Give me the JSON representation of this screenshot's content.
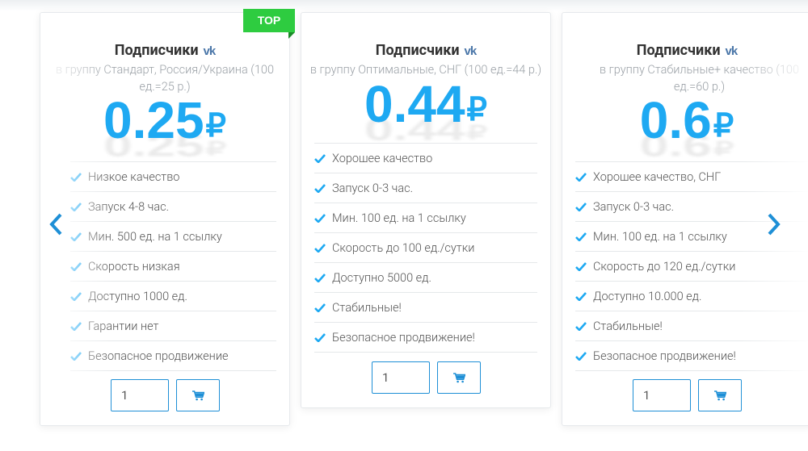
{
  "badge": "TOP",
  "colors": {
    "accent": "#1ea9f2",
    "button_border": "#1e8fd6",
    "badge": "#2ecc40",
    "check": "#1ea9f2",
    "vk": "#4a76a8"
  },
  "icons": {
    "network": "vk-icon",
    "check": "checkmark-icon",
    "cart": "cart-icon",
    "prev": "chevron-left-icon",
    "next": "chevron-right-icon"
  },
  "cards": [
    {
      "title": "Подписчики",
      "vk": "vk",
      "subtitle": "в группу Стандарт, Россия/Украина (100 ед.=25 р.)",
      "price": "0.25",
      "currency": "₽",
      "features": [
        "Низкое качество",
        "Запуск 4-8 час.",
        "Мин. 500 ед. на 1 ссылку",
        "Скорость низкая",
        "Доступно 1000 ед.",
        "Гарантии нет",
        "Безопасное продвижение"
      ],
      "quantity": "1"
    },
    {
      "title": "Подписчики",
      "vk": "vk",
      "subtitle": "в группу Оптимальные, СНГ (100 ед.=44 р.)",
      "price": "0.44",
      "currency": "₽",
      "features": [
        "Хорошее качество",
        "Запуск 0-3 час.",
        "Мин. 100 ед. на 1 ссылку",
        "Скорость до 100 ед./сутки",
        "Доступно 5000 ед.",
        "Стабильные!",
        "Безопасное продвижение!"
      ],
      "quantity": "1"
    },
    {
      "title": "Подписчики",
      "vk": "vk",
      "subtitle": "в группу Стабильные+ качество (100 ед.=60 р.)",
      "price": "0.6",
      "currency": "₽",
      "features": [
        "Хорошее качество, СНГ",
        "Запуск 0-3 час.",
        "Мин. 100 ед. на 1 ссылку",
        "Скорость до 120 ед./сутки",
        "Доступно 10.000 ед.",
        "Стабильные!",
        "Безопасное продвижение!"
      ],
      "quantity": "1"
    }
  ]
}
